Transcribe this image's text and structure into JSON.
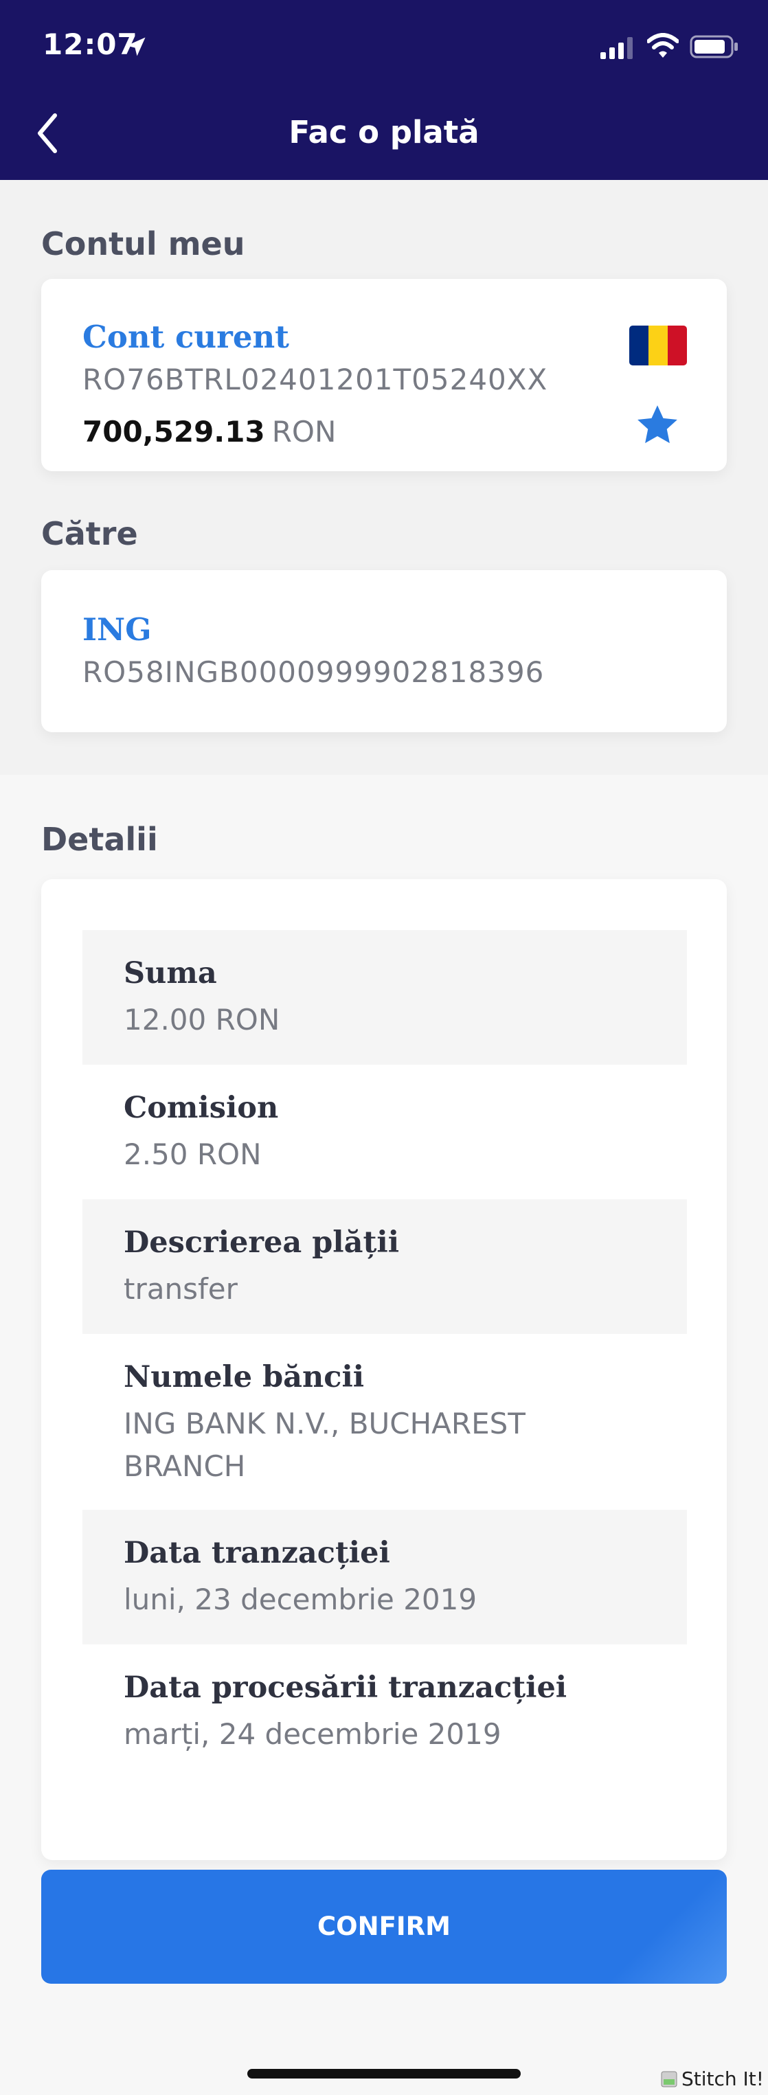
{
  "status_bar": {
    "time": "12:07"
  },
  "header": {
    "title": "Fac o plată"
  },
  "my_account": {
    "section_label": "Contul meu",
    "account_name": "Cont curent",
    "iban": "RO76BTRL02401201T05240XX",
    "balance": "700,529.13",
    "currency": "RON",
    "flag_colors": [
      "#002b7f",
      "#fcd116",
      "#ce1126"
    ],
    "star_color": "#2a7be0"
  },
  "recipient": {
    "section_label": "Către",
    "bank_name": "ING",
    "iban": "RO58INGB0000999902818396"
  },
  "details": {
    "section_label": "Detalii",
    "rows": [
      {
        "label": "Suma",
        "value": "12.00 RON"
      },
      {
        "label": "Comision",
        "value": "2.50 RON"
      },
      {
        "label": "Descrierea plății",
        "value": "transfer"
      },
      {
        "label": "Numele băncii",
        "value": "ING BANK N.V., BUCHAREST BRANCH"
      },
      {
        "label": "Data tranzacției",
        "value": "luni, 23 decembrie 2019"
      },
      {
        "label": "Data procesării tranzacției",
        "value": "marți, 24 decembrie 2019"
      }
    ]
  },
  "actions": {
    "confirm_label": "CONFIRM"
  },
  "watermark": {
    "text": "Stitch It!"
  },
  "colors": {
    "header_bg": "#1a1464",
    "accent_blue": "#2a7be0",
    "button_blue": "#2776e6"
  }
}
